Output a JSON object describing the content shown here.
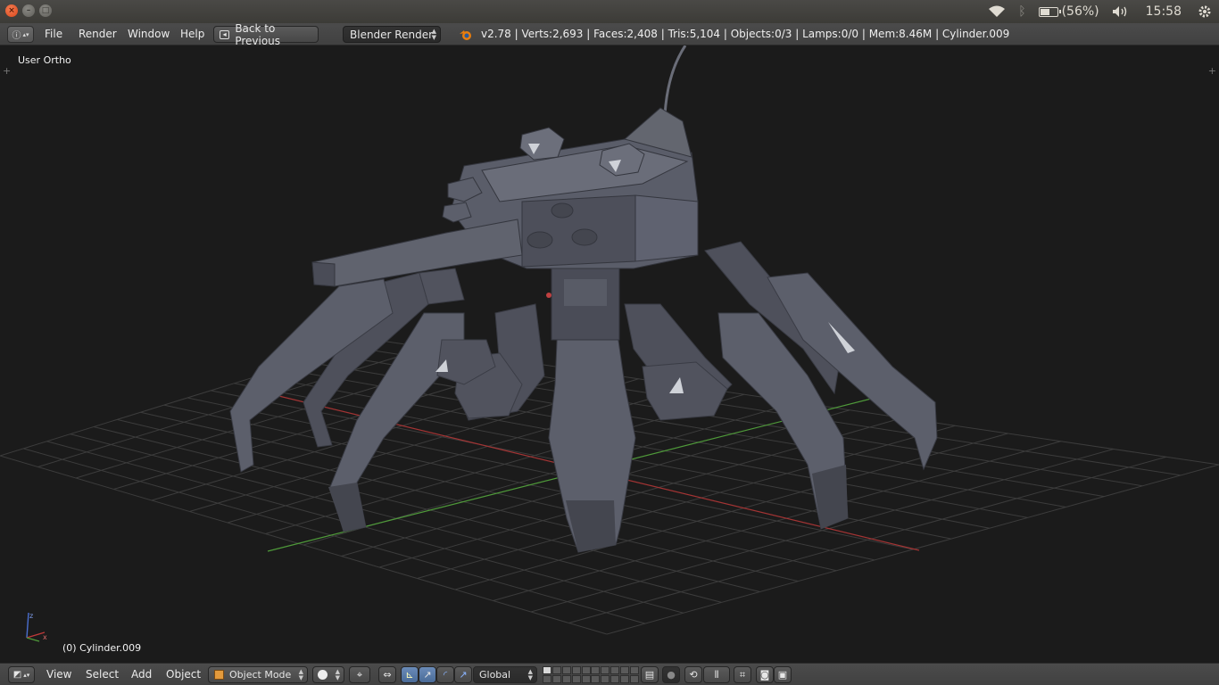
{
  "system_panel": {
    "battery_text": "(56%)",
    "battery_level": 0.56,
    "clock": "15:58",
    "icons": [
      "wifi-icon",
      "bluetooth-icon",
      "battery-icon",
      "volume-icon",
      "settings-gear-icon"
    ]
  },
  "info_header": {
    "menus": [
      "File",
      "Render",
      "Window",
      "Help"
    ],
    "back_button": "Back to Previous",
    "render_engine": "Blender Render",
    "stats": "v2.78 | Verts:2,693 | Faces:2,408 | Tris:5,104 | Objects:0/3 | Lamps:0/0 | Mem:8.46M | Cylinder.009"
  },
  "viewport": {
    "view_label": "User Ortho",
    "object_label": "(0) Cylinder.009",
    "colors": {
      "background": "#1b1b1b",
      "grid": "#3c3c3c",
      "x_axis": "#a33434",
      "y_axis": "#4f9a3a",
      "mesh": "#5c5f6b"
    }
  },
  "view_header": {
    "menus": [
      "View",
      "Select",
      "Add",
      "Object"
    ],
    "mode": "Object Mode",
    "orientation": "Global"
  }
}
